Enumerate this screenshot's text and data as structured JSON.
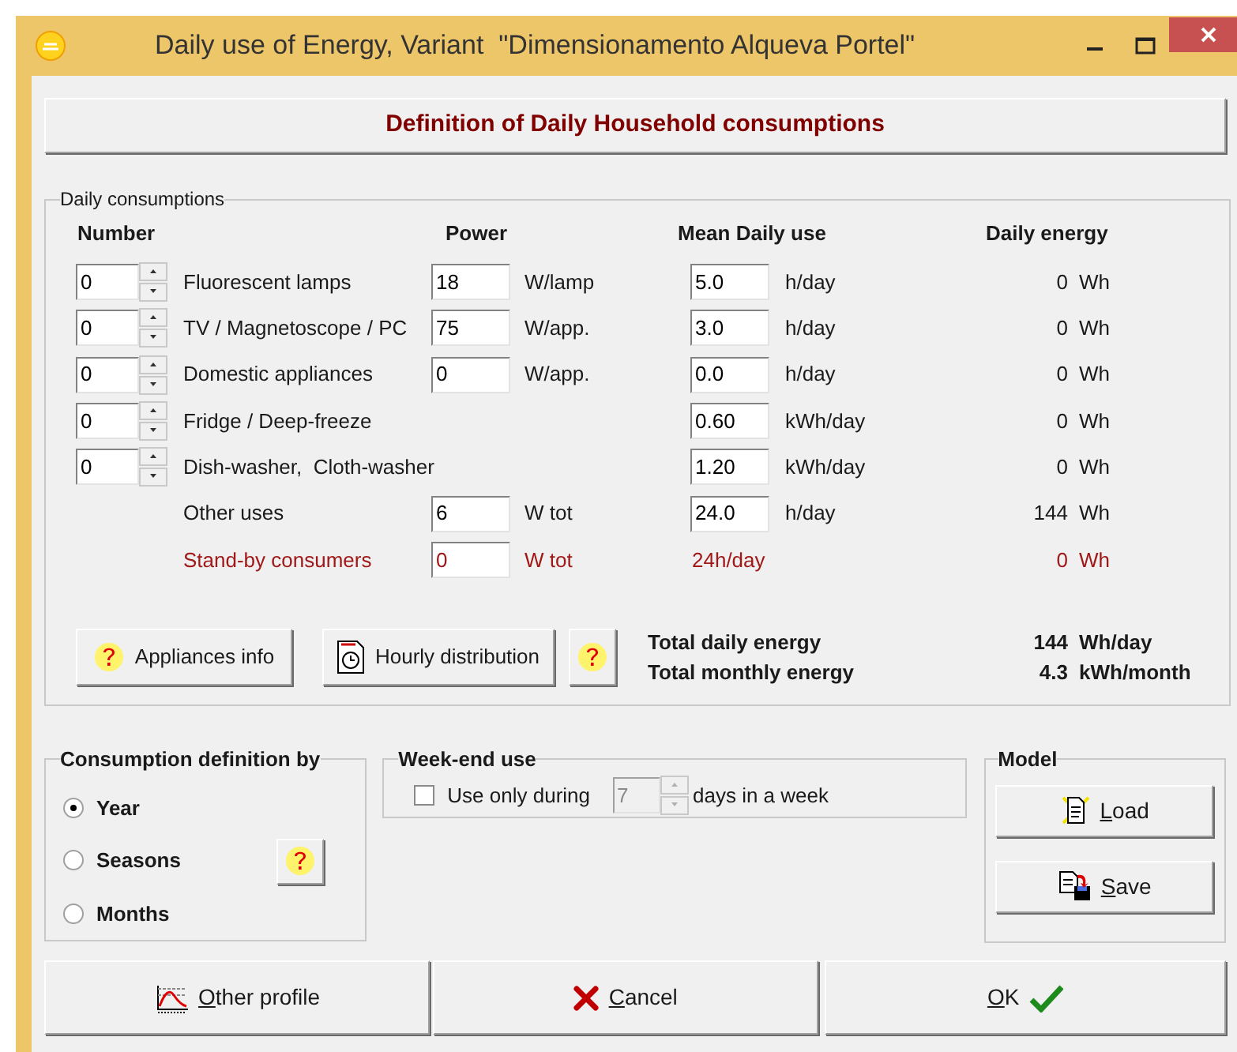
{
  "window": {
    "title": "Daily use of Energy, Variant  \"Dimensionamento Alqueva Portel\""
  },
  "header": "Definition of Daily Household consumptions",
  "daily_consumptions": {
    "title": "Daily consumptions",
    "columns": [
      "Number",
      "Power",
      "Mean Daily use",
      "Daily energy"
    ],
    "rows": [
      {
        "kind": "appliance",
        "number": "0",
        "label": "Fluorescent lamps",
        "power": "18",
        "power_unit": "W/lamp",
        "mean": "5.0",
        "mean_unit": "h/day",
        "energy": "0",
        "energy_unit": "Wh"
      },
      {
        "kind": "appliance",
        "number": "0",
        "label": "TV / Magnetoscope / PC",
        "power": "75",
        "power_unit": "W/app.",
        "mean": "3.0",
        "mean_unit": "h/day",
        "energy": "0",
        "energy_unit": "Wh"
      },
      {
        "kind": "appliance",
        "number": "0",
        "label": "Domestic appliances",
        "power": "0",
        "power_unit": "W/app.",
        "mean": "0.0",
        "mean_unit": "h/day",
        "energy": "0",
        "energy_unit": "Wh"
      },
      {
        "kind": "appliance",
        "number": "0",
        "label": "Fridge / Deep-freeze",
        "mean": "0.60",
        "mean_unit": "kWh/day",
        "energy": "0",
        "energy_unit": "Wh"
      },
      {
        "kind": "appliance",
        "number": "0",
        "label": "Dish-washer,  Cloth-washer",
        "mean": "1.20",
        "mean_unit": "kWh/day",
        "energy": "0",
        "energy_unit": "Wh"
      },
      {
        "kind": "other",
        "label": "Other uses",
        "power": "6",
        "power_unit": "W tot",
        "mean": "24.0",
        "mean_unit": "h/day",
        "energy": "144",
        "energy_unit": "Wh"
      },
      {
        "kind": "standby",
        "label": "Stand-by consumers",
        "power": "0",
        "power_unit": "W tot",
        "mean_text": "24h/day",
        "energy": "0",
        "energy_unit": "Wh"
      }
    ],
    "buttons": [
      {
        "kind": "info",
        "label": "Appliances info"
      },
      {
        "kind": "hourly",
        "label": "Hourly distribution"
      },
      {
        "kind": "help"
      }
    ],
    "totals": [
      {
        "label": "Total daily energy",
        "value": "144",
        "unit": "Wh/day"
      },
      {
        "label": "Total monthly energy",
        "value": "4.3",
        "unit": "kWh/month"
      }
    ]
  },
  "consumption_definition": {
    "title": "Consumption definition by",
    "options": [
      {
        "label": "Year",
        "selected": true
      },
      {
        "label": "Seasons",
        "selected": false
      },
      {
        "label": "Months",
        "selected": false
      }
    ]
  },
  "weekend": {
    "title": "Week-end use",
    "checkbox": {
      "label": "Use only during",
      "checked": false
    },
    "days": {
      "value": "7",
      "disabled": true
    },
    "suffix": "days in a week"
  },
  "model": {
    "title": "Model",
    "buttons": [
      {
        "kind": "load",
        "label": "Load"
      },
      {
        "kind": "save",
        "label": "Save"
      }
    ]
  },
  "footer": [
    {
      "kind": "profile",
      "label": "Other profile"
    },
    {
      "kind": "cancel",
      "label": "Cancel"
    },
    {
      "kind": "ok",
      "label": "OK"
    }
  ]
}
